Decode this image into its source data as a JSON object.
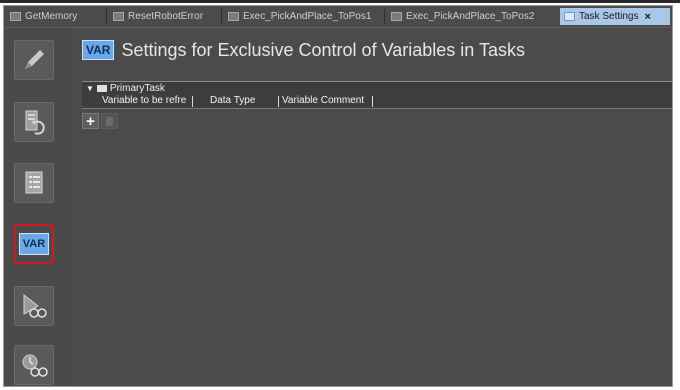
{
  "tabs": [
    {
      "label": "GetMemory",
      "icon": "document-icon",
      "active": false
    },
    {
      "label": "ResetRobotError",
      "icon": "document-icon",
      "active": false
    },
    {
      "label": "Exec_PickAndPlace_ToPos1",
      "icon": "document-icon",
      "active": false
    },
    {
      "label": "Exec_PickAndPlace_ToPos2",
      "icon": "document-icon",
      "active": false
    },
    {
      "label": "Task Settings",
      "icon": "settings-icon",
      "active": true,
      "close": "×"
    }
  ],
  "sidebar": {
    "items": [
      {
        "name": "pencil-icon",
        "selected": false
      },
      {
        "name": "program-icon",
        "selected": false
      },
      {
        "name": "list-icon",
        "selected": false
      },
      {
        "name": "var-icon",
        "label": "VAR",
        "selected": true
      },
      {
        "name": "watch-icon",
        "selected": false
      },
      {
        "name": "timer-watch-icon",
        "selected": false
      }
    ]
  },
  "header": {
    "badge": "VAR",
    "title": "Settings for Exclusive Control of Variables in Tasks"
  },
  "table": {
    "group": "PrimaryTask",
    "columns": [
      "Variable to be refre",
      "Data Type",
      "Variable Comment"
    ]
  },
  "toolbar": {
    "add_label": "+"
  },
  "colors": {
    "selection": "#d0181e",
    "active_tab": "#a9c8e8",
    "badge": "#6aa7e6"
  }
}
